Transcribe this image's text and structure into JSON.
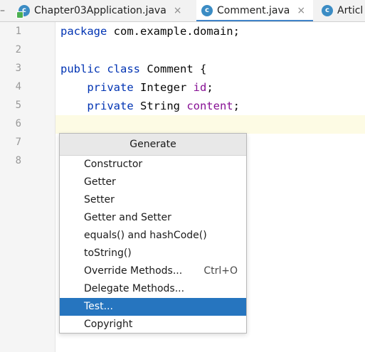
{
  "tabs": [
    {
      "label": "Chapter03Application.java",
      "icon": "java-class-icon",
      "close": "×",
      "active": false
    },
    {
      "label": "Comment.java",
      "icon": "java-class-icon",
      "close": "×",
      "active": true
    },
    {
      "label": "Articl",
      "icon": "java-class-icon",
      "active": false
    }
  ],
  "tab_icon_letter": "c",
  "editor": {
    "line_numbers": [
      "1",
      "2",
      "3",
      "4",
      "5",
      "6",
      "7",
      "8"
    ],
    "lines": {
      "l1_kw": "package",
      "l1_rest": " com.example.domain;",
      "l3_kw1": "public",
      "l3_kw2": "class",
      "l3_rest": " Comment {",
      "l4_kw": "private",
      "l4_type": " Integer ",
      "l4_field": "id",
      "l4_end": ";",
      "l5_kw": "private",
      "l5_type": " String ",
      "l5_field": "content",
      "l5_end": ";"
    }
  },
  "popup": {
    "title": "Generate",
    "items": [
      {
        "label": "Constructor"
      },
      {
        "label": "Getter"
      },
      {
        "label": "Setter"
      },
      {
        "label": "Getter and Setter"
      },
      {
        "label": "equals() and hashCode()"
      },
      {
        "label": "toString()"
      },
      {
        "label": "Override Methods...",
        "shortcut": "Ctrl+O"
      },
      {
        "label": "Delegate Methods..."
      },
      {
        "label": "Test...",
        "selected": true
      },
      {
        "label": "Copyright"
      }
    ]
  },
  "colors": {
    "keyword": "#0033b3",
    "field": "#871094",
    "selection": "#2675bf",
    "tab_underline": "#4083c9",
    "java_icon": "#3b8cc4"
  }
}
